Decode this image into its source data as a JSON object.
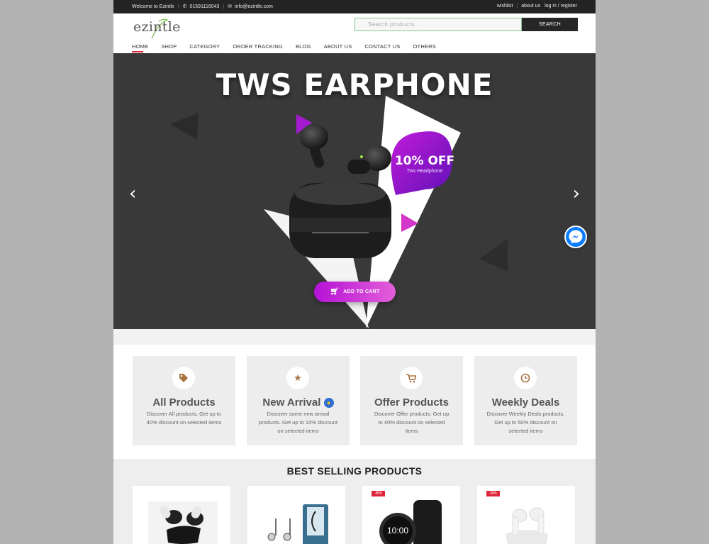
{
  "topbar": {
    "welcome": "Welcome to Ezintle",
    "phone": "01591116043",
    "email": "info@ezintle.com",
    "wishlist": "wishlist",
    "about": "about us",
    "login": "log in / register"
  },
  "brand": {
    "logo_text": "ezintle"
  },
  "search": {
    "placeholder": "Search products...",
    "button_label": "SEARCH"
  },
  "nav": {
    "items": [
      "HOME",
      "SHOP",
      "CATEGORY",
      "ORDER TRACKING",
      "BLOG",
      "ABOUT US",
      "CONTACT US",
      "OTHERS"
    ],
    "active": "HOME"
  },
  "hero": {
    "title": "TWS EARPHONE",
    "badge_percent": "10% OFF",
    "badge_sub": "Tws Headphone",
    "cta_label": "ADD TO CART",
    "prev_arrow": "‹",
    "next_arrow": "›"
  },
  "features": [
    {
      "title": "All Products",
      "desc": "Discover All products, Get up to 40% discount on selected items",
      "icon": "tags-icon"
    },
    {
      "title": "New Arrival",
      "desc": "Discover some new arrival products. Get up to 10% discount on selected items",
      "icon": "star-icon"
    },
    {
      "title": "Offer Products",
      "desc": "Discover Offer products. Get up to 40% discount on selected items",
      "icon": "cart-icon"
    },
    {
      "title": "Weekly Deals",
      "desc": "Discover Weekly Deals products. Get up to 50% discount on selected items",
      "icon": "clock-icon"
    }
  ],
  "best_selling": {
    "title": "BEST SELLING PRODUCTS",
    "products": [
      {
        "image": "black-tws-earbuds"
      },
      {
        "image": "wired-earphones"
      },
      {
        "badge": "-6%",
        "image": "smartwatch",
        "watch_time": "10:00"
      },
      {
        "badge": "-5%",
        "image": "white-earbuds"
      }
    ]
  },
  "colors": {
    "accent": "#e0243a",
    "dark": "#232323",
    "hero_bg": "#3a3939",
    "purple": "#b512d6",
    "icon_brown": "#a8733f",
    "messenger": "#0a7cff"
  }
}
